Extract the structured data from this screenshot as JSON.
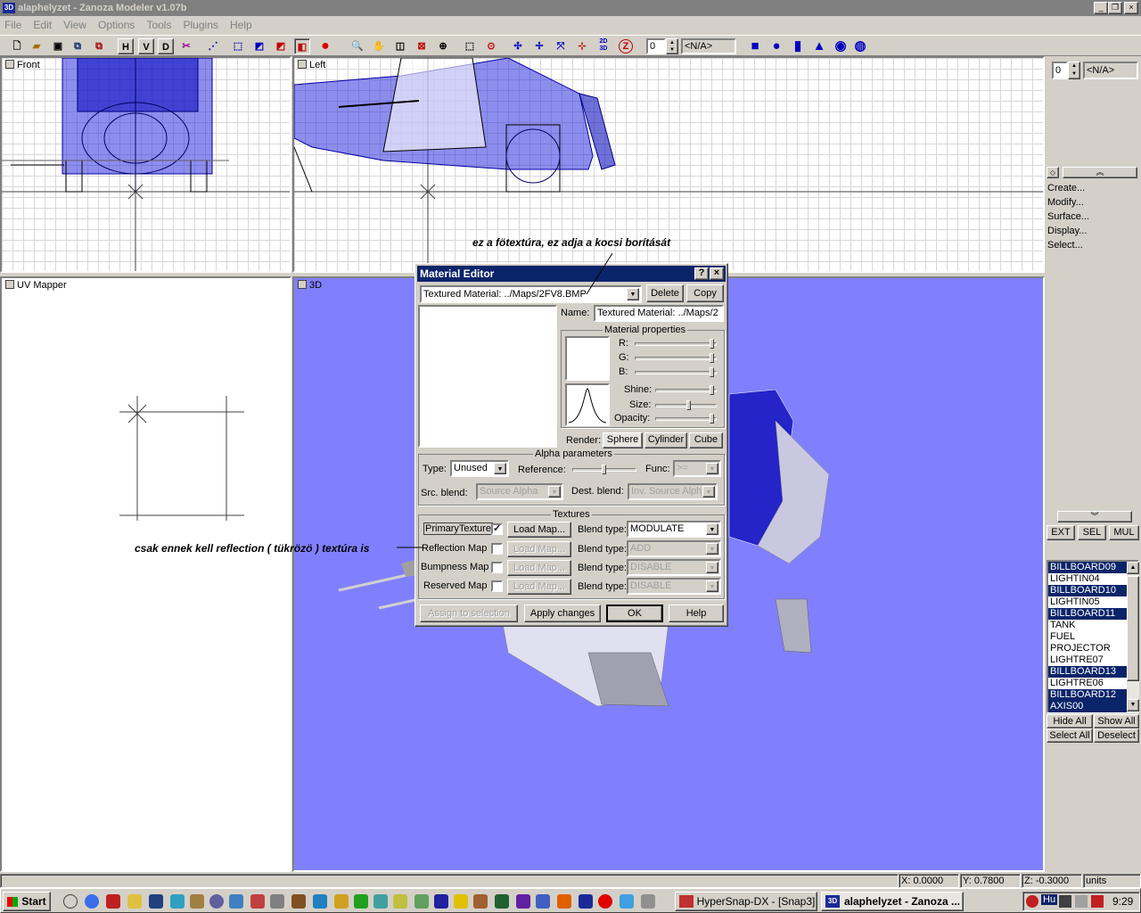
{
  "window": {
    "title": "alaphelyzet - Zanoza Modeler v1.07b",
    "icon_text": "3D"
  },
  "menu": [
    "File",
    "Edit",
    "View",
    "Options",
    "Tools",
    "Plugins",
    "Help"
  ],
  "toolbar": {
    "h_label": "H",
    "v_label": "V",
    "d_label": "D",
    "spin_value": "0",
    "na_value": "<N/A>",
    "text_2d3d": "2D 3D",
    "z_label": "Z"
  },
  "viewports": {
    "front": "Front",
    "left": "Left",
    "uv": "UV Mapper",
    "three_d": "3D"
  },
  "annotations": {
    "top": "ez a fötextúra, ez adja a kocsi borítását",
    "left": "csak ennek kell reflection ( tükrözö ) textúra is"
  },
  "material_editor": {
    "title": "Material Editor",
    "help_btn": "?",
    "close_btn": "×",
    "material_select": "Textured Material: ../Maps/2FV8.BMP",
    "delete": "Delete",
    "copy": "Copy",
    "name_label": "Name:",
    "name_value": "Textured Material: ../Maps/2",
    "material_properties": "Material properties",
    "r": "R:",
    "g": "G:",
    "b": "B:",
    "shine": "Shine:",
    "size": "Size:",
    "opacity": "Opacity:",
    "render_label": "Render:",
    "render_sphere": "Sphere",
    "render_cylinder": "Cylinder",
    "render_cube": "Cube",
    "alpha_parameters": "Alpha parameters",
    "type_label": "Type:",
    "type_value": "Unused",
    "reference_label": "Reference:",
    "func_label": "Func:",
    "func_value": ">=",
    "src_blend_label": "Src. blend:",
    "src_blend_value": "Source Alpha",
    "dest_blend_label": "Dest. blend:",
    "dest_blend_value": "Inv. Source Alph",
    "textures": "Textures",
    "rows": [
      {
        "name": "PrimaryTexture",
        "checked": "✓",
        "load": "Load Map...",
        "blend_label": "Blend type:",
        "blend": "MODULATE"
      },
      {
        "name": "Reflection Map",
        "checked": "",
        "load": "Load Map...",
        "blend_label": "Blend type:",
        "blend": "ADD"
      },
      {
        "name": "Bumpness Map",
        "checked": "",
        "load": "Load Map...",
        "blend_label": "Blend type:",
        "blend": "DISABLE"
      },
      {
        "name": "Reserved Map",
        "checked": "",
        "load": "Load Map...",
        "blend_label": "Blend type:",
        "blend": "DISABLE"
      }
    ],
    "assign": "Assign to selection",
    "apply": "Apply changes",
    "ok": "OK",
    "help": "Help"
  },
  "right_panel": {
    "spin_value": "0",
    "na_value": "<N/A>",
    "menu": [
      "Create...",
      "Modify...",
      "Surface...",
      "Display...",
      "Select..."
    ],
    "mode_buttons": [
      "EXT",
      "SEL",
      "MUL"
    ],
    "objects": [
      {
        "name": "BILLBOARD09",
        "selected": true
      },
      {
        "name": "LIGHTIN04",
        "selected": false
      },
      {
        "name": "BILLBOARD10",
        "selected": true
      },
      {
        "name": "LIGHTIN05",
        "selected": false
      },
      {
        "name": "BILLBOARD11",
        "selected": true
      },
      {
        "name": "TANK",
        "selected": false
      },
      {
        "name": "FUEL",
        "selected": false
      },
      {
        "name": "PROJECTOR",
        "selected": false
      },
      {
        "name": "LIGHTRE07",
        "selected": false
      },
      {
        "name": "BILLBOARD13",
        "selected": true
      },
      {
        "name": "LIGHTRE06",
        "selected": false
      },
      {
        "name": "BILLBOARD12",
        "selected": true
      },
      {
        "name": "AXIS00",
        "selected": true
      }
    ],
    "hide_all": "Hide All",
    "show_all": "Show All",
    "select_all": "Select All",
    "deselect": "Deselect"
  },
  "status": {
    "x": "X: 0.0000",
    "y": "Y: 0.7800",
    "z": "Z: -0.3000",
    "units": "units"
  },
  "taskbar": {
    "start": "Start",
    "tasks": [
      "HyperSnap-DX - [Snap3]",
      "alaphelyzet - Zanoza ..."
    ],
    "task_icons": [
      "",
      "3D"
    ],
    "lang": "Hu",
    "clock": "9:29"
  },
  "colors": {
    "title_active": "#0a246a",
    "viewport_3d_bg": "#8080ff",
    "wireframe_blue": "#2020e0",
    "selection": "#0a246a"
  }
}
